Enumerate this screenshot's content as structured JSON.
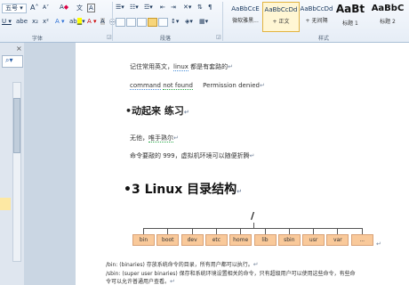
{
  "ribbon": {
    "font_name": "五号",
    "font_size_label": "A",
    "font_shrink_label": "A",
    "font_group_label": "字体",
    "paragraph_group_label": "段落",
    "styles_group_label": "样式",
    "styles": [
      {
        "sample": "AaBbCcE",
        "name": "微软雅黑..."
      },
      {
        "sample": "AaBbCcDd",
        "name": "+ 正文"
      },
      {
        "sample": "AaBbCcDd",
        "name": "+ 无间隔"
      },
      {
        "sample": "AaBt",
        "name": "标题 1"
      },
      {
        "sample": "AaBbC",
        "name": "标题 2"
      }
    ]
  },
  "doc": {
    "line1_pre": "记住常用英文，",
    "line1_word": "linux",
    "line1_post": " 都是有套路的",
    "line2_a": "command",
    "line2_b": "not found",
    "line2_c": "Permission denied",
    "heading_small": "动起来 练习",
    "line3_pre": "无他，",
    "line3_word": "唯手熟尔",
    "line4": "命令要敲的 999，虚拟机环境可以随便折腾",
    "heading_big": "3  Linux 目录结构",
    "tree_root": "/",
    "tree_nodes": [
      "bin",
      "boot",
      "dev",
      "etc",
      "home",
      "lib",
      "sbin",
      "usr",
      "var",
      "..."
    ],
    "bottom1": "/bin: (binaries) 存放系统命令的目录，所有用户都可以执行。",
    "bottom2": "/sbin: (super user binaries) 保存和系统环境设置相关的命令，只有超级用户可以使用这些命令，有些命",
    "bottom3": "令可以允许普通用户查看。"
  }
}
